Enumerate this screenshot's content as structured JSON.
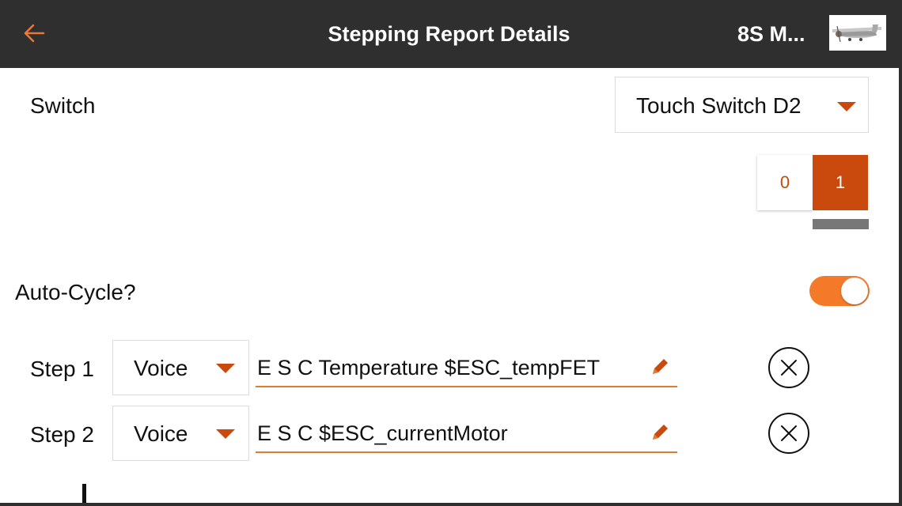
{
  "header": {
    "title": "Stepping Report Details",
    "model_name": "8S M...",
    "model_image": "airplane-thumbnail"
  },
  "switch_row": {
    "label": "Switch",
    "selected": "Touch Switch D2"
  },
  "switch_positions": {
    "options": [
      "0",
      "1"
    ],
    "selected": "1"
  },
  "auto_cycle": {
    "label": "Auto-Cycle?",
    "enabled": true
  },
  "steps": [
    {
      "label": "Step 1",
      "type": "Voice",
      "text": "E S C Temperature $ESC_tempFET"
    },
    {
      "label": "Step 2",
      "type": "Voice",
      "text": "E S C $ESC_currentMotor"
    }
  ],
  "icons": {
    "back": "back-arrow-icon",
    "caret": "caret-down-icon",
    "edit": "pencil-icon",
    "remove": "remove-circle-x-icon",
    "add": "plus-icon"
  },
  "colors": {
    "header_bg": "#2f2f2f",
    "accent": "#c94a0c",
    "toggle_on": "#f47a2a",
    "underline": "#e07a35",
    "indicator": "#777777"
  }
}
